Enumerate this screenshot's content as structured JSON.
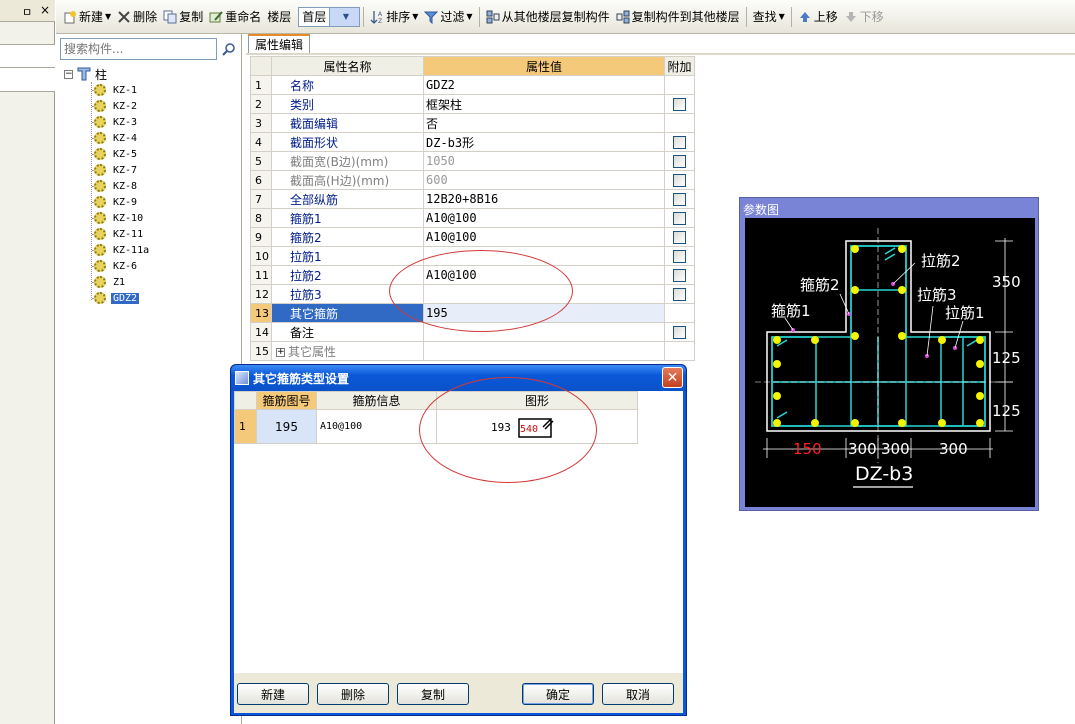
{
  "toolbar": {
    "new": "新建",
    "delete": "删除",
    "copy": "复制",
    "rename": "重命名",
    "floor_label": "楼层",
    "floor_value": "首层",
    "sort": "排序",
    "filter": "过滤",
    "copy_from_floor": "从其他楼层复制构件",
    "copy_to_floor": "复制构件到其他楼层",
    "find": "查找",
    "move_up": "上移",
    "move_down": "下移"
  },
  "left_strip": {
    "pin": "ㅁ",
    "close": "×"
  },
  "tree": {
    "search_placeholder": "搜索构件...",
    "root": "柱",
    "items": [
      "KZ-1",
      "KZ-2",
      "KZ-3",
      "KZ-4",
      "KZ-5",
      "KZ-7",
      "KZ-8",
      "KZ-9",
      "KZ-10",
      "KZ-11",
      "KZ-11a",
      "KZ-6",
      "Z1",
      "GDZ2"
    ],
    "selected": "GDZ2"
  },
  "property_editor": {
    "tab": "属性编辑",
    "columns": [
      "属性名称",
      "属性值",
      "附加"
    ],
    "rows": [
      {
        "n": "1",
        "name": "名称",
        "value": "GDZ2"
      },
      {
        "n": "2",
        "name": "类别",
        "value": "框架柱"
      },
      {
        "n": "3",
        "name": "截面编辑",
        "value": "否"
      },
      {
        "n": "4",
        "name": "截面形状",
        "value": "DZ-b3形"
      },
      {
        "n": "5",
        "name": "截面宽(B边)(mm)",
        "value": "1050"
      },
      {
        "n": "6",
        "name": "截面高(H边)(mm)",
        "value": "600"
      },
      {
        "n": "7",
        "name": "全部纵筋",
        "value": "12B20+8B16"
      },
      {
        "n": "8",
        "name": "箍筋1",
        "value": "A10@100"
      },
      {
        "n": "9",
        "name": "箍筋2",
        "value": "A10@100"
      },
      {
        "n": "10",
        "name": "拉筋1",
        "value": ""
      },
      {
        "n": "11",
        "name": "拉筋2",
        "value": "A10@100"
      },
      {
        "n": "12",
        "name": "拉筋3",
        "value": ""
      },
      {
        "n": "13",
        "name": "其它箍筋",
        "value": "195"
      },
      {
        "n": "14",
        "name": "备注",
        "value": ""
      },
      {
        "n": "15",
        "name": "其它属性",
        "value": ""
      }
    ]
  },
  "param_diagram": {
    "title": "参数图",
    "labels": {
      "stirrup2": "箍筋2",
      "stirrup1": "箍筋1",
      "tie2": "拉筋2",
      "tie3": "拉筋3",
      "tie1": "拉筋1",
      "dim_350": "350",
      "dim_125a": "125",
      "dim_125b": "125",
      "dim_150": "150",
      "dim_300a": "300",
      "dim_300b": "300",
      "dim_300c": "300",
      "shape_name": "DZ-b3"
    }
  },
  "dialog": {
    "title": "其它箍筋类型设置",
    "close": "✕",
    "columns": [
      "箍筋图号",
      "箍筋信息",
      "图形"
    ],
    "row": {
      "n": "1",
      "no": "195",
      "info": "A10@100",
      "shape_left": "193",
      "shape_inner": "540"
    },
    "buttons": {
      "new": "新建",
      "delete": "删除",
      "copy": "复制",
      "ok": "确定",
      "cancel": "取消"
    }
  }
}
